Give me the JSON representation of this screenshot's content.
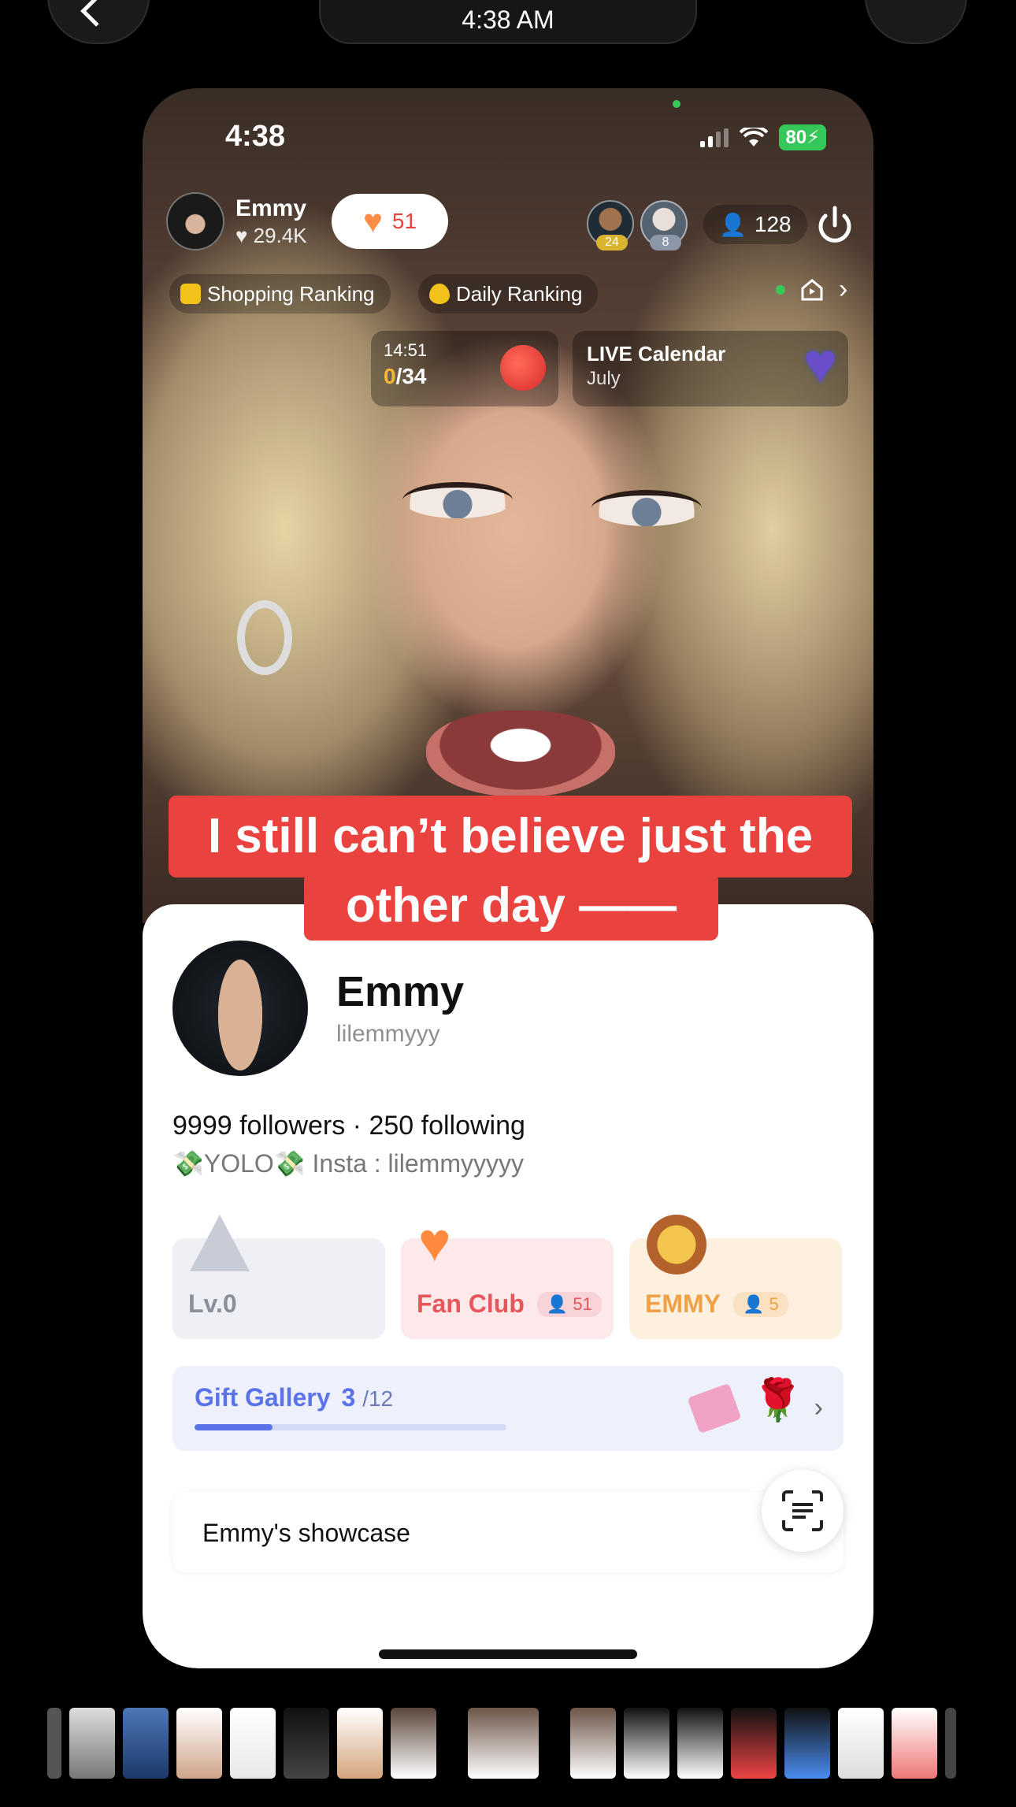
{
  "system_bar": {
    "time": "4:38 AM"
  },
  "status_bar": {
    "time": "4:38",
    "battery": "80"
  },
  "live": {
    "host_name": "Emmy",
    "host_likes": "29.4K",
    "follow_count": "51",
    "viewer_badges": [
      "24",
      "8"
    ],
    "viewer_count": "128",
    "rankings": [
      "Shopping Ranking",
      "Daily Ranking"
    ],
    "goal": {
      "time": "14:51",
      "current": "0",
      "total": "/34"
    },
    "calendar": {
      "title": "LIVE Calendar",
      "month": "July"
    }
  },
  "caption": {
    "line1": "I still can’t believe just the",
    "line2": "other day ——"
  },
  "profile": {
    "name": "Emmy",
    "handle": "lilemmyyy",
    "stats": "9999 followers · 250 following",
    "bio": "💸YOLO💸 Insta : lilemmyyyyy",
    "cards": [
      {
        "label": "Lv.0",
        "count": ""
      },
      {
        "label": "Fan Club",
        "count": "51"
      },
      {
        "label": "EMMY",
        "count": "5"
      }
    ],
    "gift_gallery": {
      "label": "Gift Gallery",
      "collected": "3",
      "total": "/12",
      "progress": 0.25
    },
    "showcase": "Emmy's showcase"
  },
  "colors": {
    "caption_bg": "#e9423f",
    "accent_blue": "#5b73e8",
    "fan_club": "#e6565a",
    "emmy_orange": "#f0a046"
  }
}
